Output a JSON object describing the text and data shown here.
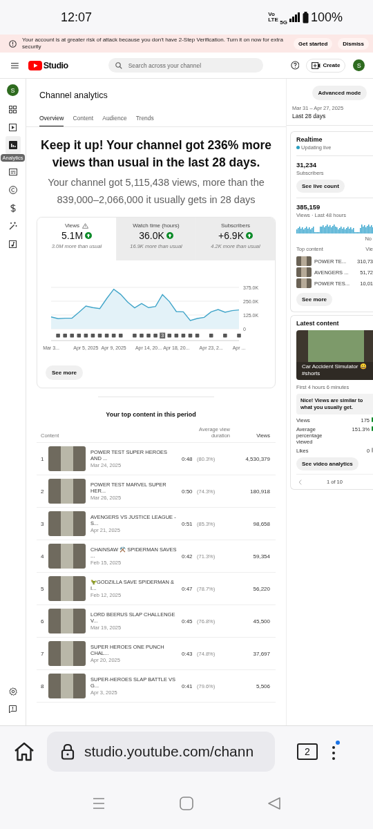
{
  "status_bar": {
    "time": "12:07",
    "network": "Vo LTE",
    "network_type": "5G",
    "battery": "100%"
  },
  "banner": {
    "message": "Your account is at greater risk of attack because you don't have 2-Step Verification. Turn it on now for extra security",
    "buttons": [
      "Get started",
      "Dismiss"
    ]
  },
  "header": {
    "logo_text": "Studio",
    "search": {
      "placeholder": "Search across your channel"
    },
    "create_label": "Create",
    "avatar_letter": "S"
  },
  "sidebar": {
    "avatar_letter": "S",
    "tooltip": "Analytics",
    "items": [
      {
        "kind": "dashboard",
        "selected": false
      },
      {
        "kind": "content",
        "selected": false
      },
      {
        "kind": "analytics",
        "selected": true
      },
      {
        "kind": "subtitles",
        "selected": false
      },
      {
        "kind": "copyright",
        "selected": false
      },
      {
        "kind": "earn",
        "selected": false
      },
      {
        "kind": "customize",
        "selected": false
      },
      {
        "kind": "audio",
        "selected": false
      }
    ],
    "bottom_items": [
      {
        "kind": "settings"
      },
      {
        "kind": "feedback"
      }
    ]
  },
  "page": {
    "title": "Channel analytics",
    "tabs": [
      {
        "label": "Overview",
        "selected": true
      },
      {
        "label": "Content",
        "selected": false
      },
      {
        "label": "Audience",
        "selected": false
      },
      {
        "label": "Trends",
        "selected": false
      }
    ],
    "advanced_mode": "Advanced mode",
    "date_range": "Mar 31 – Apr 27, 2025",
    "period": "Last 28 days"
  },
  "summary": {
    "headline": "Keep it up! Your channel got 236% more views than usual in the last 28 days.",
    "detail": "Your channel got 5,115,438 views, more than the 839,000–2,066,000 it usually gets in 28 days"
  },
  "metrics": [
    {
      "label": "Views",
      "warning": true,
      "value": "5.1M",
      "increase": true,
      "note": "3.0M more than usual",
      "selected": true
    },
    {
      "label": "Watch time (hours)",
      "warning": false,
      "value": "36.0K",
      "increase": true,
      "note": "16.9K more than usual",
      "selected": false
    },
    {
      "label": "Subscribers",
      "warning": false,
      "value": "+6.9K",
      "increase": true,
      "note": "4.2K more than usual",
      "selected": false
    }
  ],
  "chart_data": {
    "type": "area",
    "ylim": [
      0,
      375000
    ],
    "categories": [
      "Mar 3...",
      null,
      null,
      null,
      null,
      "Apr 5, 2025",
      null,
      null,
      null,
      "Apr 9, 2025",
      null,
      null,
      null,
      null,
      "Apr 14, 20...",
      null,
      null,
      null,
      "Apr 18, 20...",
      null,
      null,
      null,
      null,
      "Apr 23, 2...",
      null,
      null,
      null,
      "Apr ..."
    ],
    "yticks": [
      {
        "value": 0,
        "label": "0"
      },
      {
        "value": 125000,
        "label": "125.0K"
      },
      {
        "value": 250000,
        "label": "250.0K"
      },
      {
        "value": 375000,
        "label": "375.0K"
      }
    ],
    "series": [
      {
        "color": "#41a5c9",
        "values": [
          108000,
          92000,
          96000,
          96000,
          150000,
          206000,
          192000,
          183000,
          275000,
          358000,
          312000,
          242000,
          190000,
          229000,
          192000,
          202000,
          310000,
          246000,
          156000,
          154000,
          75000,
          94000,
          104000,
          154000,
          175000,
          150000,
          165000,
          171000
        ]
      }
    ]
  },
  "chart_marker_badge": "3",
  "see_more": "See more",
  "top_content": {
    "title": "Your top content in this period",
    "columns": [
      "Content",
      "Average view duration",
      "Views"
    ],
    "rows": [
      {
        "rank": "1",
        "title": "POWER TEST SUPER HEROES AND ...",
        "date": "Mar 24, 2025",
        "duration": "0:48",
        "percent": "(80.3%)",
        "views": "4,530,379"
      },
      {
        "rank": "2",
        "title": "POWER TEST MARVEL SUPER HER...",
        "date": "Mar 26, 2025",
        "duration": "0:50",
        "percent": "(74.3%)",
        "views": "180,918"
      },
      {
        "rank": "3",
        "title": "AVENGERS VS JUSTICE LEAGUE - S...",
        "date": "Apr 21, 2025",
        "duration": "0:51",
        "percent": "(85.3%)",
        "views": "98,658"
      },
      {
        "rank": "4",
        "title": "CHAINSAW ⚒️ SPIDERMAN SAVES ...",
        "date": "Feb 15, 2025",
        "duration": "0:42",
        "percent": "(71.3%)",
        "views": "59,354"
      },
      {
        "rank": "5",
        "title": "🦖GODZILLA SAVE SPIDERMAN & I...",
        "date": "Feb 12, 2025",
        "duration": "0:47",
        "percent": "(78.7%)",
        "views": "56,220"
      },
      {
        "rank": "6",
        "title": "LORD BEERUS SLAP CHALLENGE V...",
        "date": "Mar 19, 2025",
        "duration": "0:45",
        "percent": "(76.8%)",
        "views": "45,500"
      },
      {
        "rank": "7",
        "title": "SUPER HEROES ONE PUNCH CHAL...",
        "date": "Apr 20, 2025",
        "duration": "0:43",
        "percent": "(74.8%)",
        "views": "37,697"
      },
      {
        "rank": "8",
        "title": "SUPER-HEROES SLAP BATTLE VS G...",
        "date": "Apr 3, 2025",
        "duration": "0:41",
        "percent": "(79.6%)",
        "views": "5,506"
      }
    ]
  },
  "realtime": {
    "title": "Realtime",
    "status": "Updating live",
    "subscribers": "31,234",
    "subscribers_label": "Subscribers",
    "live_count_button": "See live count",
    "views": "385,159",
    "views_label": "Views · Last 48 hours",
    "sparkline_label": "No",
    "top_content_label": "Top content",
    "views_column": "Vie",
    "items": [
      {
        "title": "POWER TE...",
        "views": "310,73"
      },
      {
        "title": "AVENGERS ...",
        "views": "51,72"
      },
      {
        "title": "POWER TES...",
        "views": "10,01"
      }
    ],
    "see_more": "See more"
  },
  "latest_content": {
    "title": "Latest content",
    "video_title": "Car Accident Simulator 😀 #shorts",
    "period": "First 4 hours 6 minutes",
    "message": "Nice! Views are similar to what you usually get.",
    "stats": [
      {
        "label": "Views",
        "value": "175",
        "positive": true
      },
      {
        "label": "Average percentage viewed",
        "value": "151.3%",
        "positive": true
      },
      {
        "label": "Likes",
        "value": "0",
        "positive": false
      }
    ],
    "button": "See video analytics",
    "pager": "1 of 10"
  },
  "browser": {
    "url": "studio.youtube.com/chann",
    "tab_count": "2"
  }
}
